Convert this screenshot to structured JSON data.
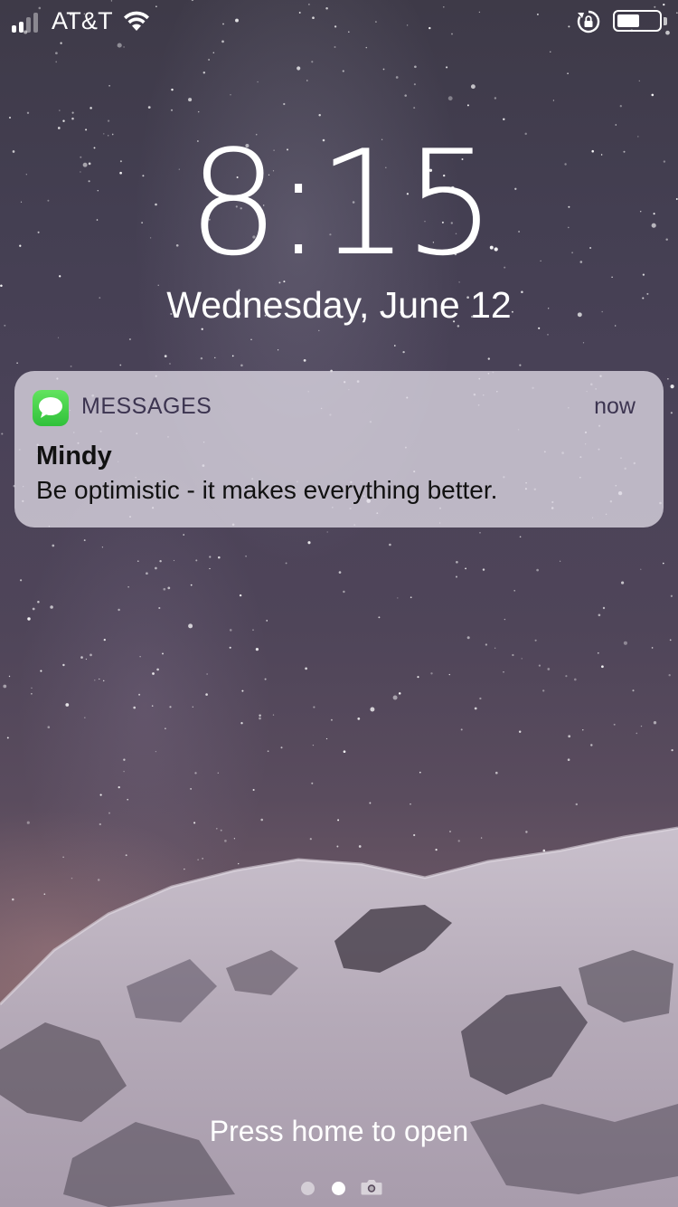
{
  "status_bar": {
    "carrier": "AT&T",
    "signal_bars": 4,
    "signal_bars_filled": 2,
    "battery_level": 0.55,
    "icons": [
      "signal-icon",
      "wifi-icon",
      "rotation-lock-icon",
      "battery-icon"
    ]
  },
  "lock_screen": {
    "time": "8:15",
    "date": "Wednesday, June 12",
    "unlock_hint": "Press home to open"
  },
  "notification": {
    "app_name": "MESSAGES",
    "app_icon": "messages-icon",
    "time": "now",
    "sender": "Mindy",
    "message": "Be optimistic - it makes everything better."
  },
  "page_indicator": {
    "pages": 2,
    "active_page": 2,
    "trailing_icon": "camera-icon"
  },
  "colors": {
    "messages_green": "#4cd964",
    "text_white": "#ffffff",
    "notification_bg": "#ded8e4"
  }
}
